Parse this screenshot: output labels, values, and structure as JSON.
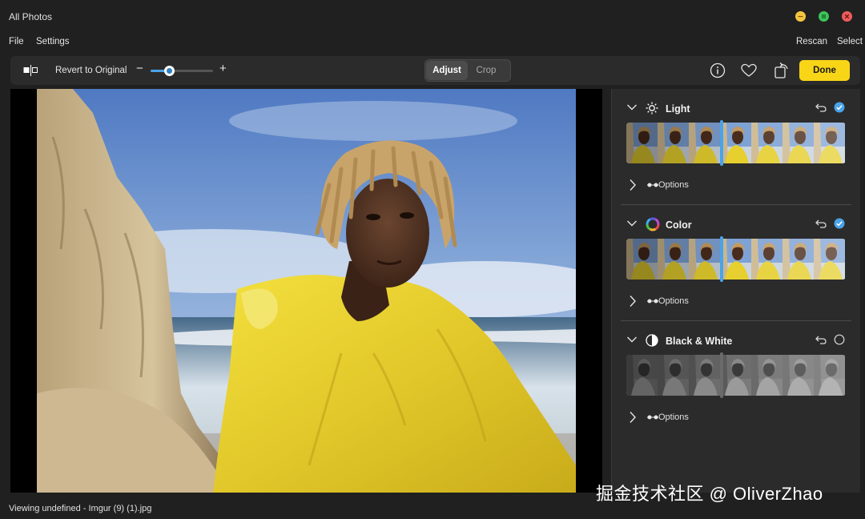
{
  "window": {
    "title": "All Photos",
    "controls": {
      "minimize_color": "#f5c542",
      "maximize_color": "#3cc35a",
      "close_color": "#ee5c5c"
    }
  },
  "menu": {
    "left": [
      "File",
      "Settings"
    ],
    "right": [
      "Rescan",
      "Select"
    ]
  },
  "toolbar": {
    "compare_icon": "compare-icon",
    "revert_label": "Revert to Original",
    "zoom": {
      "minus": "−",
      "plus": "+",
      "level": 0.3
    },
    "segments": {
      "adjust": "Adjust",
      "crop": "Crop",
      "active": "Adjust"
    },
    "icons": [
      "info-icon",
      "heart-icon",
      "rotate-icon"
    ],
    "done_label": "Done",
    "accent": "#f8d517"
  },
  "panel": {
    "sections": [
      {
        "title": "Light",
        "icon": "sun-icon",
        "enabled": true,
        "options_label": "Options",
        "strip": "color"
      },
      {
        "title": "Color",
        "icon": "color-wheel-icon",
        "enabled": true,
        "options_label": "Options",
        "strip": "color"
      },
      {
        "title": "Black & White",
        "icon": "contrast-icon",
        "enabled": false,
        "options_label": "Options",
        "strip": "mono"
      }
    ],
    "marker_color": "#4aa3e8"
  },
  "status": {
    "text": "Viewing undefined - Imgur (9) (1).jpg"
  },
  "watermark": "掘金技术社区 @ OliverZhao"
}
